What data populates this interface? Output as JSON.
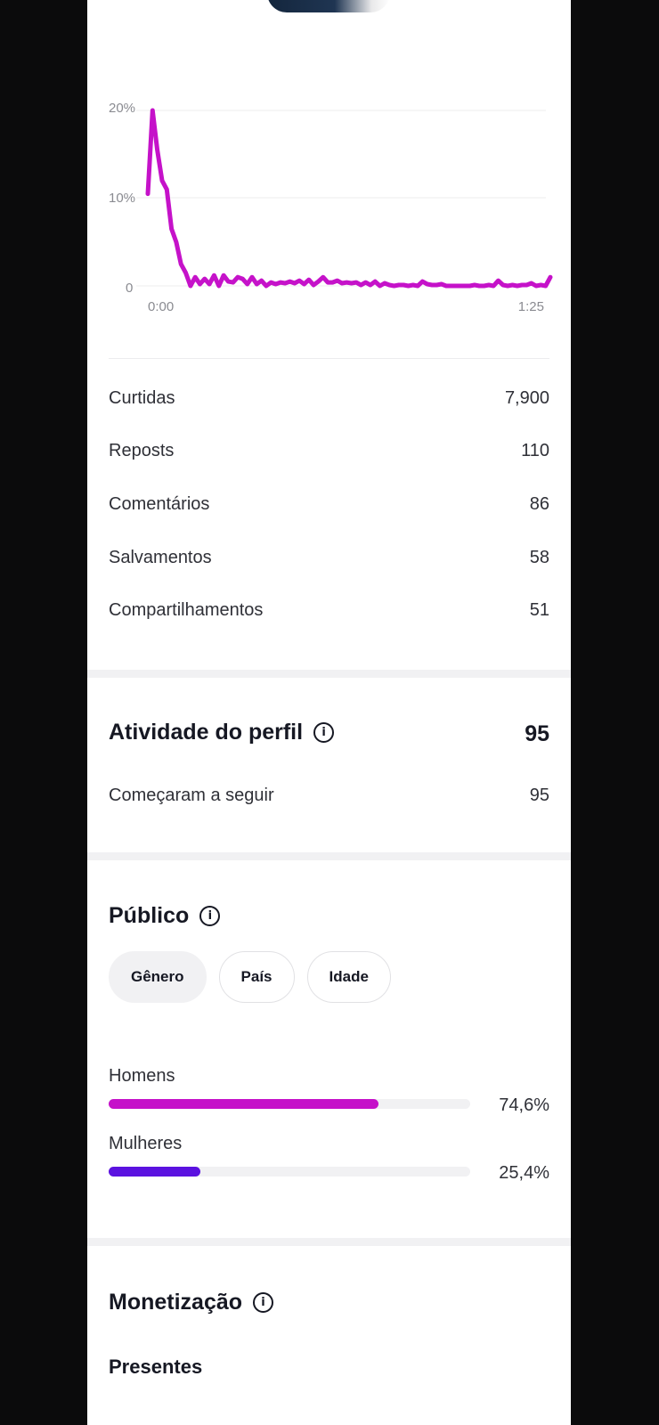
{
  "colors": {
    "accent": "#c512c9",
    "secondary": "#5b12e0",
    "track": "#f1f1f3"
  },
  "chart_data": {
    "type": "line",
    "x_ticks": [
      "0:00",
      "1:25"
    ],
    "y_ticks": [
      "20%",
      "10%",
      "0"
    ],
    "ylim": [
      0,
      20
    ],
    "x_range_seconds": [
      0,
      85
    ],
    "series": [
      {
        "values": [
          10.5,
          20,
          15.5,
          12,
          11,
          6.5,
          5,
          2.5,
          1.5,
          0,
          1,
          0.2,
          0.8,
          0.2,
          1.2,
          0,
          1.2,
          0.5,
          0.4,
          1,
          0.8,
          0.2,
          1,
          0.2,
          0.6,
          0,
          0.4,
          0.2,
          0.4,
          0.3,
          0.5,
          0.3,
          0.6,
          0.2,
          0.7,
          0.1,
          0.5,
          1,
          0.4,
          0.4,
          0.6,
          0.3,
          0.4,
          0.3,
          0.4,
          0.1,
          0.4,
          0.1,
          0.5,
          0,
          0.3,
          0.1,
          0,
          0.1,
          0.1,
          0,
          0.1,
          0,
          0.5,
          0.2,
          0.1,
          0.1,
          0.2,
          0,
          0,
          0,
          0,
          0,
          0,
          0.1,
          0,
          0,
          0.1,
          0,
          0.6,
          0.1,
          0,
          0.1,
          0,
          0.1,
          0.1,
          0.3,
          0,
          0.1,
          0,
          1
        ]
      }
    ]
  },
  "metrics": [
    {
      "label": "Curtidas",
      "value": "7,900"
    },
    {
      "label": "Reposts",
      "value": "110"
    },
    {
      "label": "Comentários",
      "value": "86"
    },
    {
      "label": "Salvamentos",
      "value": "58"
    },
    {
      "label": "Compartilhamentos",
      "value": "51"
    }
  ],
  "profile_activity": {
    "title": "Atividade do perfil",
    "total": "95",
    "rows": [
      {
        "label": "Começaram a seguir",
        "value": "95"
      }
    ]
  },
  "audience": {
    "title": "Público",
    "tabs": [
      "Gênero",
      "País",
      "Idade"
    ],
    "selected_tab": "Gênero",
    "gender": [
      {
        "label": "Homens",
        "pct_text": "74,6%",
        "fraction": 0.746,
        "color": "#c512c9"
      },
      {
        "label": "Mulheres",
        "pct_text": "25,4%",
        "fraction": 0.254,
        "color": "#5b12e0"
      }
    ]
  },
  "monetization": {
    "title": "Monetização",
    "sub": "Presentes"
  },
  "icons": {
    "info": "info-icon"
  }
}
